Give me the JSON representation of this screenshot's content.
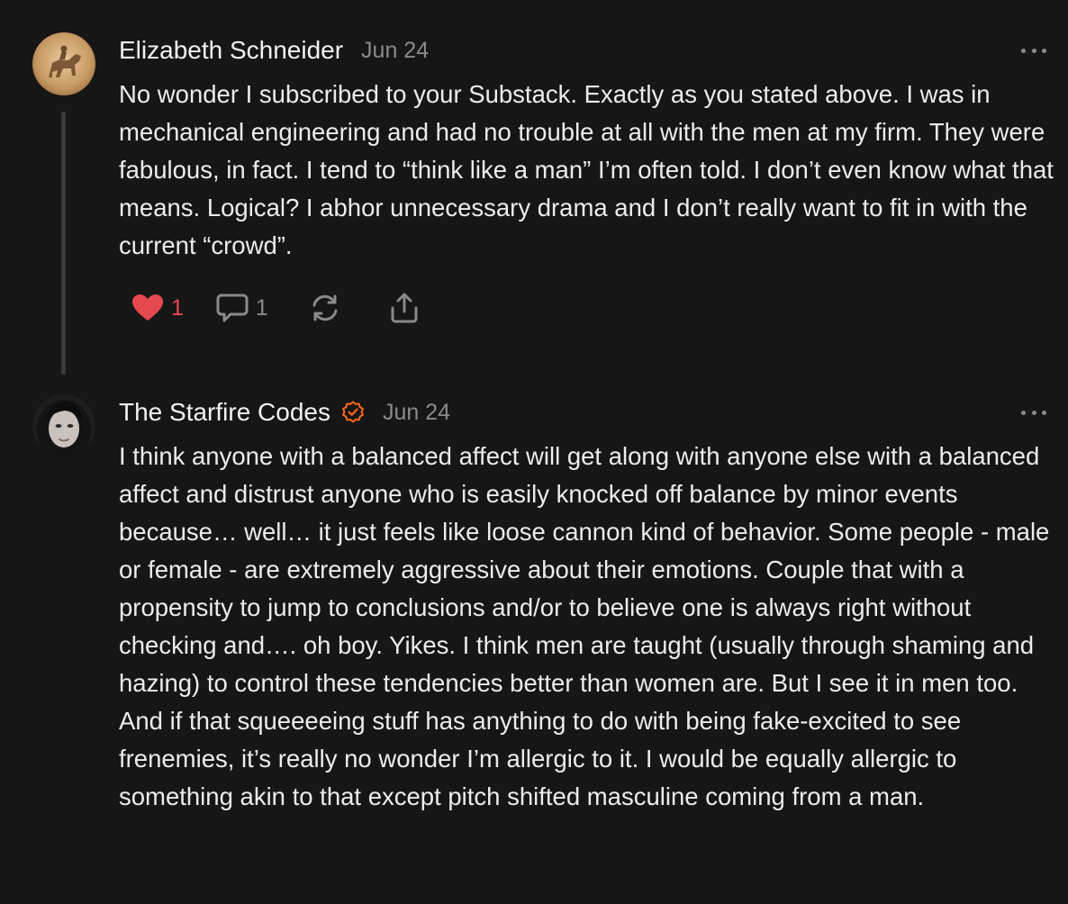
{
  "comments": [
    {
      "author": "Elizabeth Schneider",
      "date": "Jun 24",
      "avatar_icon": "horse-sketch-avatar",
      "verified": false,
      "text": "No wonder I subscribed to your Substack. Exactly as you stated above. I was in mechanical engineering and had no trouble at all with the men at my firm. They were fabulous, in fact. I tend to “think like a man” I’m often told. I don’t even know what that means. Logical? I abhor unnecessary drama and I don’t really want to fit in with the current “crowd”.",
      "likes": "1",
      "replies": "1"
    },
    {
      "author": "The Starfire Codes",
      "date": "Jun 24",
      "avatar_icon": "woman-portrait-avatar",
      "verified": true,
      "text": "I think anyone with a balanced affect will get along with anyone else with a balanced affect and distrust anyone who is easily knocked off balance by minor events because… well… it just feels like loose cannon kind of behavior. Some people - male or female - are extremely aggressive about their emotions. Couple that with a propensity to jump to conclusions and/or to believe one is always right without checking and…. oh boy. Yikes. I think men are taught (usually through shaming and hazing) to control these tendencies better than women are. But I see it in men too. And if that squeeeeing stuff has anything to do with being fake-excited to see frenemies, it’s really no wonder I’m allergic to it. I would be equally allergic to something akin to that except pitch shifted masculine coming from a man."
    }
  ],
  "colors": {
    "background": "#161616",
    "text": "#ececec",
    "muted": "#8a8a8a",
    "like": "#e5484d",
    "verified": "#ff6719"
  }
}
